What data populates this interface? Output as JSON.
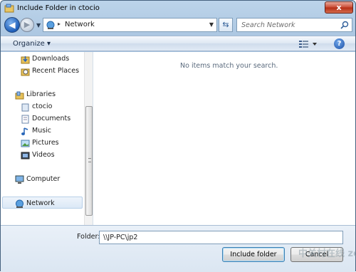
{
  "window": {
    "title": "Include Folder in ctocio",
    "close_label": "x"
  },
  "address_bar": {
    "location": "Network",
    "separator": "▸"
  },
  "search": {
    "placeholder": "Search Network"
  },
  "toolbar": {
    "organize_label": "Organize ▾",
    "help_label": "?"
  },
  "nav_pane": {
    "items": [
      {
        "label": "Downloads",
        "icon": "downloads-icon"
      },
      {
        "label": "Recent Places",
        "icon": "recent-places-icon"
      },
      {
        "label": "Libraries",
        "icon": "libraries-icon"
      },
      {
        "label": "ctocio",
        "icon": "library-icon"
      },
      {
        "label": "Documents",
        "icon": "documents-icon"
      },
      {
        "label": "Music",
        "icon": "music-icon"
      },
      {
        "label": "Pictures",
        "icon": "pictures-icon"
      },
      {
        "label": "Videos",
        "icon": "videos-icon"
      },
      {
        "label": "Computer",
        "icon": "computer-icon"
      },
      {
        "label": "Network",
        "icon": "network-icon",
        "selected": true
      }
    ]
  },
  "file_list": {
    "empty_message": "No items match your search."
  },
  "footer": {
    "folder_label": "Folder:",
    "folder_value": "\\\\JP-PC\\jp2",
    "include_button": "Include folder",
    "cancel_button": "Cancel",
    "watermark": "中关村在线 zol.com.cn"
  }
}
